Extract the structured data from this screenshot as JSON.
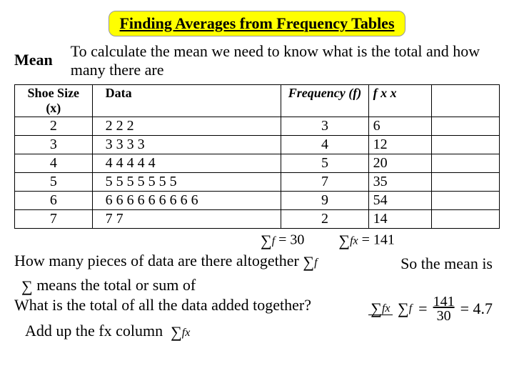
{
  "title": "Finding Averages from Frequency Tables",
  "mean_label": "Mean",
  "intro": "To calculate the mean we need to know what is the total and how many there are",
  "headers": {
    "x": "Shoe Size (x)",
    "data": "Data",
    "f": "Frequency (f)",
    "fx": "f x x"
  },
  "rows": [
    {
      "x": "2",
      "data": "2 2 2",
      "f": "3",
      "fx": "6"
    },
    {
      "x": "3",
      "data": "3 3 3 3",
      "f": "4",
      "fx": "12"
    },
    {
      "x": "4",
      "data": "4 4 4 4 4",
      "f": "5",
      "fx": "20"
    },
    {
      "x": "5",
      "data": "5 5 5 5 5 5 5",
      "f": "7",
      "fx": "35"
    },
    {
      "x": "6",
      "data": "6 6 6 6 6 6 6 6 6",
      "f": "9",
      "fx": "54"
    },
    {
      "x": "7",
      "data": "7  7",
      "f": "2",
      "fx": "14"
    }
  ],
  "sum_f": "= 30",
  "sum_fx": "= 141",
  "q_howmany": "How many pieces of data are there altogether",
  "so_mean": "So the mean is",
  "means_total": "means the total or sum of",
  "q_total": "What is the total of all the data added together?",
  "addup": "Add up the fx column",
  "result_eq": "=",
  "result_num": "141",
  "result_den": "30",
  "result_final": "= 4.7",
  "chart_data": {
    "type": "table",
    "title": "Finding Averages from Frequency Tables",
    "columns": [
      "Shoe Size (x)",
      "Frequency (f)",
      "f × x"
    ],
    "x": [
      2,
      3,
      4,
      5,
      6,
      7
    ],
    "frequency": [
      3,
      4,
      5,
      7,
      9,
      2
    ],
    "fx": [
      6,
      12,
      20,
      35,
      54,
      14
    ],
    "sum_f": 30,
    "sum_fx": 141,
    "mean": 4.7
  }
}
